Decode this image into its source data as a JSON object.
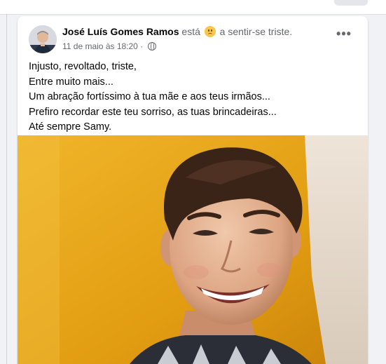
{
  "post": {
    "author": "José Luís Gomes Ramos",
    "feeling_prefix": "está",
    "feeling_text": "a sentir-se triste.",
    "feeling_icon": "sad-emoji-icon",
    "timestamp": "11 de maio às 18:20",
    "separator": "·",
    "privacy_icon": "globe-icon",
    "more_icon": "more-options-icon",
    "body_lines": [
      "Injusto, revoltado, triste,",
      "Entre muito mais...",
      "Um abração fortíssimo à tua mãe e aos teus irmãos...",
      "Prefiro recordar este teu sorriso, as tuas brincadeiras...",
      "Até sempre Samy."
    ],
    "photo_desc": "smiling-teen-selfie-photo"
  },
  "colors": {
    "background": "#f0f2f5",
    "card": "#ffffff",
    "secondary_text": "#65676b",
    "primary_text": "#050505",
    "photo_wall": "#e6a417"
  }
}
